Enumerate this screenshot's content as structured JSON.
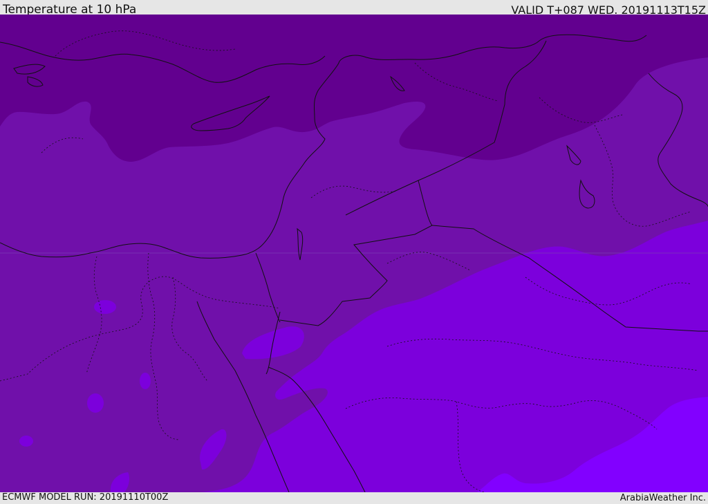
{
  "header": {
    "title": "Temperature at 10 hPa",
    "valid": "VALID T+087 WED. 20191113T15Z"
  },
  "footer": {
    "model_run": "ECMWF MODEL RUN: 20191110T00Z",
    "credit": "ArabiaWeather Inc."
  },
  "map": {
    "colors": {
      "band_dark": "#62008f",
      "band_mid_dark": "#6a08a0",
      "band_mid": "#7010aa",
      "band_light": "#7c00dc",
      "band_lightest": "#8200ff",
      "border_color": "#111111"
    }
  }
}
